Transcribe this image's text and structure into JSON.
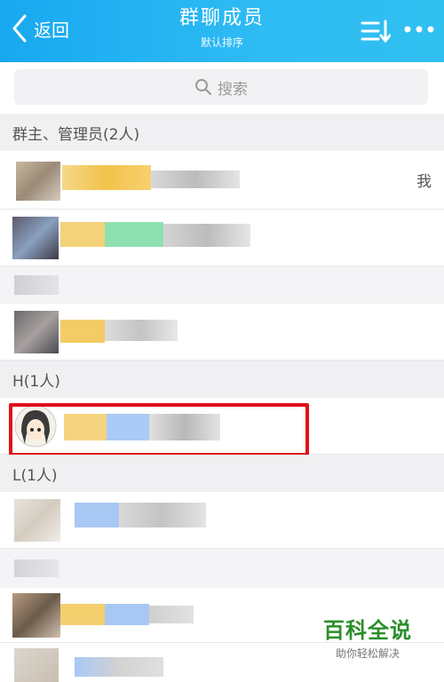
{
  "header": {
    "back_label": "返回",
    "title": "群聊成员",
    "subtitle": "默认排序",
    "back_icon": "chevron-left-icon",
    "sort_icon": "sort-list-icon",
    "more_icon": "more-dots-icon"
  },
  "search": {
    "placeholder": "搜索"
  },
  "sections": [
    {
      "label": "群主、管理员(2人)"
    },
    {
      "label": "H(1人)"
    },
    {
      "label": "L(1人)"
    }
  ],
  "members": {
    "me_label": "我"
  },
  "watermark": {
    "main": "百科全说",
    "sub": "助你轻松解决"
  },
  "colors": {
    "header_accent": "#1aa9f0",
    "highlight_border": "#e0101a",
    "watermark_green": "#2a8f2a"
  }
}
